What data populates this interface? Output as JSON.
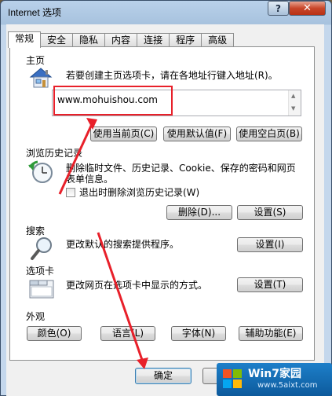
{
  "window": {
    "title": "Internet 选项",
    "help_glyph": "?",
    "close_glyph": "✕"
  },
  "tabs": [
    "常规",
    "安全",
    "隐私",
    "内容",
    "连接",
    "程序",
    "高级"
  ],
  "home": {
    "section": "主页",
    "description": "若要创建主页选项卡，请在各地址行键入地址(R)。",
    "url": "www.mohuishou.com",
    "buttons": [
      "使用当前页(C)",
      "使用默认值(F)",
      "使用空白页(B)"
    ]
  },
  "history": {
    "section": "浏览历史记录",
    "description_line1": "删除临时文件、历史记录、Cookie、保存的密码和网页",
    "description_line2": "表单信息。",
    "checkbox_label": "退出时删除浏览历史记录(W)",
    "checkbox_checked": false,
    "delete_button": "删除(D)...",
    "settings_button": "设置(S)"
  },
  "search": {
    "section": "搜索",
    "description": "更改默认的搜索提供程序。",
    "settings_button": "设置(I)"
  },
  "tabs_section": {
    "section": "选项卡",
    "description": "更改网页在选项卡中显示的方式。",
    "settings_button": "设置(T)"
  },
  "appearance": {
    "section": "外观",
    "buttons": [
      "颜色(O)",
      "语言(L)",
      "字体(N)",
      "辅助功能(E)"
    ]
  },
  "footer": {
    "ok_button": "确定"
  },
  "watermark": {
    "main": "Win7家园",
    "sub": "www.5aixt.com"
  },
  "colors": {
    "annotation_red": "#e8202a",
    "close_red": "#c8462a",
    "watermark_blue": "#1d7fc9"
  }
}
